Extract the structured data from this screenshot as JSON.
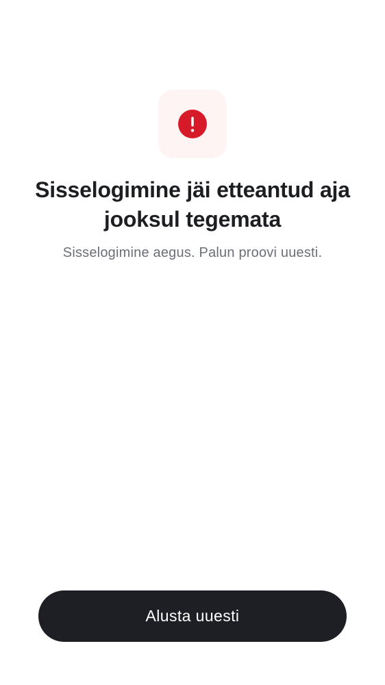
{
  "status": {
    "icon": "alert-circle-icon",
    "icon_color": "#d71a2a",
    "tile_color": "#fef4f3"
  },
  "message": {
    "title": "Sisselogimine jäi etteantud aja jooksul tegemata",
    "subtitle": "Sisselogimine aegus. Palun proovi uuesti."
  },
  "actions": {
    "restart_label": "Alusta uuesti",
    "button_color": "#1e1f24"
  }
}
